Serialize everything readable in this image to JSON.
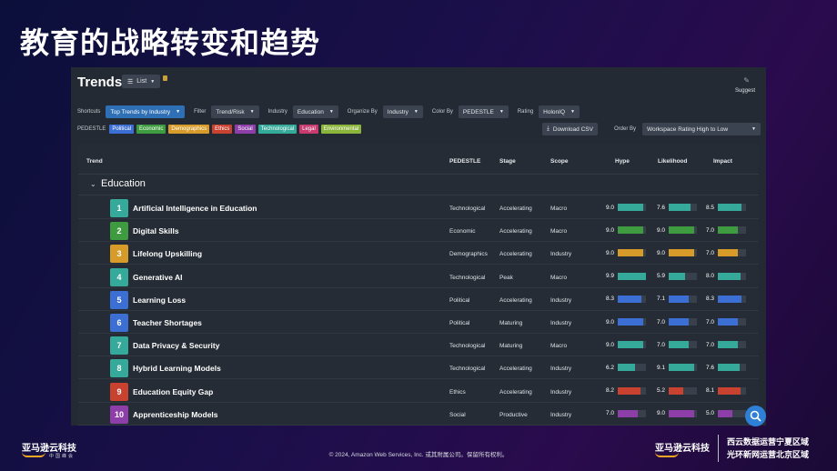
{
  "slide": {
    "title": "教育的战略转变和趋势"
  },
  "app": {
    "title": "Trends",
    "view_label": "List",
    "suggest_label": "Suggest",
    "filters": {
      "shortcuts": {
        "label": "Shortcuts",
        "value": "Top Trends by Industry"
      },
      "filter": {
        "label": "Filter",
        "value": "Trend/Risk"
      },
      "industry": {
        "label": "Industry",
        "value": "Education"
      },
      "organize_by": {
        "label": "Organize By",
        "value": "Industry"
      },
      "color_by": {
        "label": "Color By",
        "value": "PEDESTLE"
      },
      "rating": {
        "label": "Rating",
        "value": "HolonIQ"
      }
    },
    "pedestle": {
      "label": "PEDESTLE",
      "chips": [
        {
          "label": "Political",
          "color": "#3b6fd4"
        },
        {
          "label": "Economic",
          "color": "#3f9b3f"
        },
        {
          "label": "Demographics",
          "color": "#d79b2a"
        },
        {
          "label": "Ethics",
          "color": "#c9412f"
        },
        {
          "label": "Social",
          "color": "#8e3ea8"
        },
        {
          "label": "Technological",
          "color": "#35a99a"
        },
        {
          "label": "Legal",
          "color": "#c73b6e"
        },
        {
          "label": "Environmental",
          "color": "#8ab43a"
        }
      ]
    },
    "download_label": "Download CSV",
    "order_by": {
      "label": "Order By",
      "value": "Workspace Rating High to Low"
    }
  },
  "table": {
    "headers": {
      "trend": "Trend",
      "pedestle": "PEDESTLE",
      "stage": "Stage",
      "scope": "Scope",
      "hype": "Hype",
      "likelihood": "Likelihood",
      "impact": "Impact"
    },
    "group": "Education",
    "rows": [
      {
        "rank": "1",
        "name": "Artificial Intelligence in Education",
        "pedestle": "Technological",
        "stage": "Accelerating",
        "scope": "Macro",
        "hype": "9.0",
        "likelihood": "7.6",
        "impact": "8.5",
        "color": "#35a99a"
      },
      {
        "rank": "2",
        "name": "Digital Skills",
        "pedestle": "Economic",
        "stage": "Accelerating",
        "scope": "Macro",
        "hype": "9.0",
        "likelihood": "9.0",
        "impact": "7.0",
        "color": "#3f9b3f"
      },
      {
        "rank": "3",
        "name": "Lifelong Upskilling",
        "pedestle": "Demographics",
        "stage": "Accelerating",
        "scope": "Industry",
        "hype": "9.0",
        "likelihood": "9.0",
        "impact": "7.0",
        "color": "#d79b2a"
      },
      {
        "rank": "4",
        "name": "Generative AI",
        "pedestle": "Technological",
        "stage": "Peak",
        "scope": "Macro",
        "hype": "9.9",
        "likelihood": "5.9",
        "impact": "8.0",
        "color": "#35a99a"
      },
      {
        "rank": "5",
        "name": "Learning Loss",
        "pedestle": "Political",
        "stage": "Accelerating",
        "scope": "Industry",
        "hype": "8.3",
        "likelihood": "7.1",
        "impact": "8.3",
        "color": "#3b6fd4"
      },
      {
        "rank": "6",
        "name": "Teacher Shortages",
        "pedestle": "Political",
        "stage": "Maturing",
        "scope": "Industry",
        "hype": "9.0",
        "likelihood": "7.0",
        "impact": "7.0",
        "color": "#3b6fd4"
      },
      {
        "rank": "7",
        "name": "Data Privacy & Security",
        "pedestle": "Technological",
        "stage": "Maturing",
        "scope": "Macro",
        "hype": "9.0",
        "likelihood": "7.0",
        "impact": "7.0",
        "color": "#35a99a"
      },
      {
        "rank": "8",
        "name": "Hybrid Learning Models",
        "pedestle": "Technological",
        "stage": "Accelerating",
        "scope": "Industry",
        "hype": "6.2",
        "likelihood": "9.1",
        "impact": "7.6",
        "color": "#35a99a"
      },
      {
        "rank": "9",
        "name": "Education Equity Gap",
        "pedestle": "Ethics",
        "stage": "Accelerating",
        "scope": "Industry",
        "hype": "8.2",
        "likelihood": "5.2",
        "impact": "8.1",
        "color": "#c9412f"
      },
      {
        "rank": "10",
        "name": "Apprenticeship Models",
        "pedestle": "Social",
        "stage": "Productive",
        "scope": "Industry",
        "hype": "7.0",
        "likelihood": "9.0",
        "impact": "5.0",
        "color": "#8e3ea8"
      }
    ]
  },
  "footer": {
    "logo_left": "亚马逊云科技",
    "logo_left_sub": "中国峰会",
    "copyright": "© 2024, Amazon Web Services, Inc. 或其附属公司。保留所有权利。",
    "logo_right": "亚马逊云科技",
    "region_line1": "西云数据运营宁夏区域",
    "region_line2": "光环新网运营北京区域"
  }
}
